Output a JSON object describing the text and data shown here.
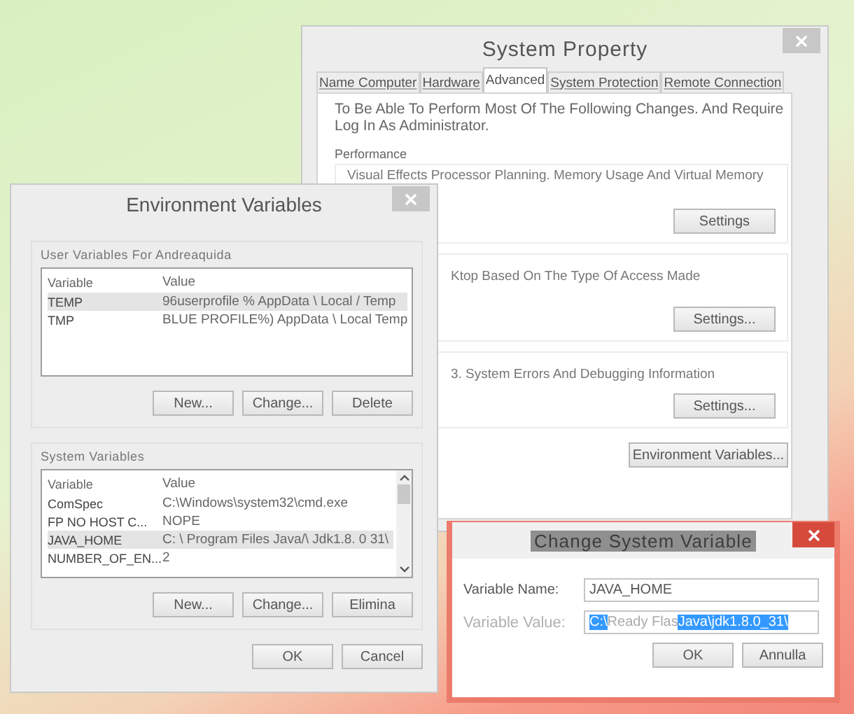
{
  "system_properties": {
    "title": "System Property",
    "tabs": [
      {
        "label": "Name Computer",
        "selected": false
      },
      {
        "label": "Hardware",
        "selected": false
      },
      {
        "label": "Advanced",
        "selected": true
      },
      {
        "label": "System Protection",
        "selected": false
      },
      {
        "label": "Remote Connection",
        "selected": false
      }
    ],
    "intro": [
      "To Be Able To Perform Most Of The Following Changes. And Require",
      "Log In As Administrator."
    ],
    "groups": [
      {
        "label": "Performance",
        "description": "Visual Effects Processor Planning. Memory Usage And Virtual Memory",
        "button": "Settings"
      },
      {
        "description": "Ktop Based On The Type Of Access Made",
        "button": "Settings..."
      },
      {
        "description": "3. System Errors And Debugging Information",
        "button": "Settings..."
      }
    ],
    "environment_button": "Environment Variables..."
  },
  "environment_variables": {
    "title": "Environment Variables",
    "sections": [
      {
        "label": "User Variables For Andreaquida",
        "columns": [
          "Variable",
          "Value"
        ],
        "scrollbar": false,
        "rows": [
          {
            "variable": "TEMP",
            "value": "96userprofile % AppData \\ Local / Temp",
            "selected": true
          },
          {
            "variable": "TMP",
            "value": "BLUE PROFILE%) AppData \\ Local Temp",
            "selected": false
          }
        ],
        "buttons": [
          "New...",
          "Change...",
          "Delete"
        ]
      },
      {
        "label": "System Variables",
        "columns": [
          "Variable",
          "Value"
        ],
        "scrollbar": true,
        "rows": [
          {
            "variable": "ComSpec",
            "value": "C:\\Windows\\system32\\cmd.exe",
            "selected": false
          },
          {
            "variable": "FP NO HOST C...",
            "value": "NOPE",
            "selected": false
          },
          {
            "variable": "JAVA_HOME",
            "value": "C: \\ Program Files Java/\\ Jdk1.8. 0 31\\",
            "selected": true
          },
          {
            "variable": "NUMBER_OF_EN...",
            "value": "2",
            "selected": false
          }
        ],
        "buttons": [
          "New...",
          "Change...",
          "Elimina"
        ]
      }
    ],
    "buttons": [
      "OK",
      "Cancel"
    ]
  },
  "change_dialog": {
    "title": "Change System Variable",
    "title_selected": true,
    "name_label": "Variable Name:",
    "name_value": "JAVA_HOME",
    "value_label": "Variable Value:",
    "value_label_disabled": true,
    "value_segments": [
      {
        "text": "C:\\",
        "selected": true
      },
      {
        "text": "Ready Flas",
        "selected": false
      },
      {
        "text": "Java\\jdk1.8.0_31\\",
        "selected": true
      }
    ],
    "buttons": [
      "OK",
      "Annulla"
    ]
  }
}
